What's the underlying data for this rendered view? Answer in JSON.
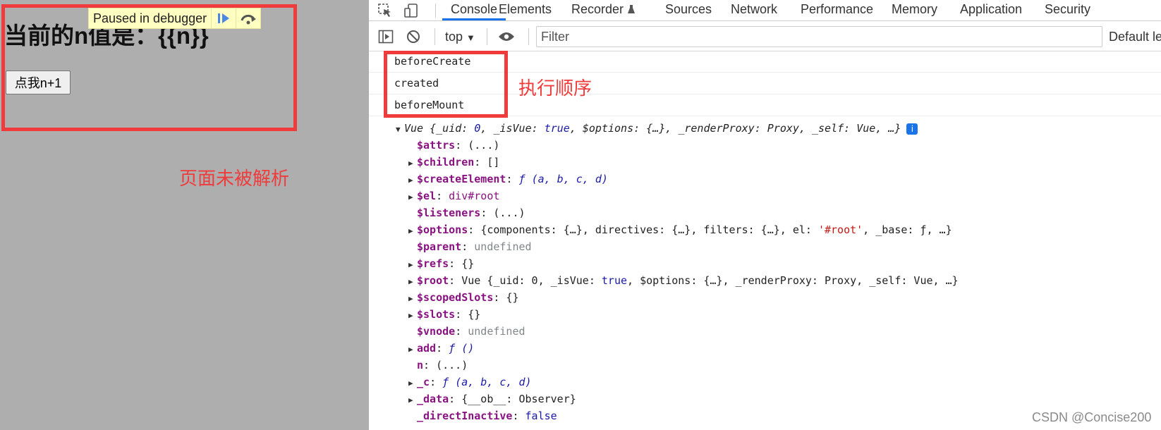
{
  "page": {
    "paused_text": "Paused in debugger",
    "heading": "当前的n值是：{{n}}",
    "button_label": "点我n+1",
    "annotation": "页面未被解析"
  },
  "devtools": {
    "tabs": [
      {
        "label": "Console",
        "active": true
      },
      {
        "label": "Elements"
      },
      {
        "label": "Recorder"
      },
      {
        "label": "Sources"
      },
      {
        "label": "Network"
      },
      {
        "label": "Performance"
      },
      {
        "label": "Memory"
      },
      {
        "label": "Application"
      },
      {
        "label": "Security"
      }
    ],
    "context": "top",
    "filter_placeholder": "Filter",
    "default_levels": "Default le",
    "messages": [
      "beforeCreate",
      "created",
      "beforeMount"
    ],
    "annotation": "执行顺序",
    "object_summary": {
      "name": "Vue",
      "uid_val": "0",
      "isVue_val": "true",
      "renderProxy": "Proxy",
      "self_val": "Vue"
    },
    "properties": [
      {
        "key": "$attrs",
        "value": "(...)"
      },
      {
        "key": "$children",
        "value": "[]"
      },
      {
        "key": "$createElement",
        "value": "(a, b, c, d)"
      },
      {
        "key": "$el",
        "value": "div#root"
      },
      {
        "key": "$listeners",
        "value": "(...)"
      },
      {
        "key": "$options",
        "value": "{components: {…}, directives: {…}, filters: {…}, el: ",
        "str": "'#root'",
        "tail": ", _base: ƒ, …}"
      },
      {
        "key": "$parent",
        "value": "undefined"
      },
      {
        "key": "$refs",
        "value": "{}"
      },
      {
        "key": "$root",
        "value": "Vue {_uid: 0, _isVue: ",
        "kw": "true",
        "tail": ", $options: {…}, _renderProxy: Proxy, _self: Vue, …}"
      },
      {
        "key": "$scopedSlots",
        "value": "{}"
      },
      {
        "key": "$slots",
        "value": "{}"
      },
      {
        "key": "$vnode",
        "value": "undefined"
      },
      {
        "key": "add",
        "value": "()"
      },
      {
        "key": "n",
        "value": "(...)"
      },
      {
        "key": "_c",
        "value": "(a, b, c, d)"
      },
      {
        "key": "_data",
        "value": "{__ob__: Observer}"
      },
      {
        "key": "_directInactive",
        "value": "false"
      }
    ]
  },
  "watermark": "CSDN @Concise200",
  "colors": {
    "annotation_red": "#ef3b3b",
    "accent_blue": "#1a73e8"
  }
}
